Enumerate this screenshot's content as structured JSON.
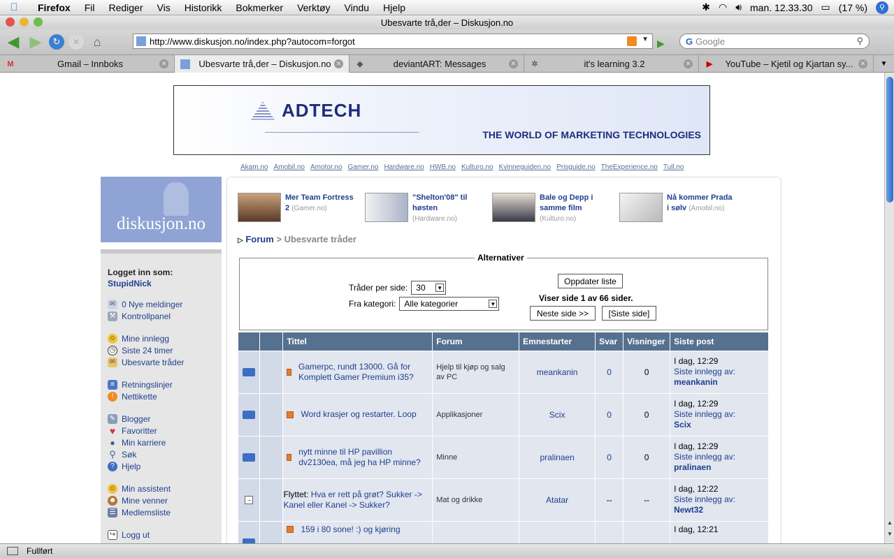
{
  "os_menu": {
    "app": "Firefox",
    "items": [
      "Fil",
      "Rediger",
      "Vis",
      "Historikk",
      "Bokmerker",
      "Verktøy",
      "Vindu",
      "Hjelp"
    ],
    "clock": "man. 12.33.30",
    "battery": "(17 %)"
  },
  "window": {
    "title": "Ubesvarte trå,der – Diskusjon.no"
  },
  "toolbar": {
    "url": "http://www.diskusjon.no/index.php?autocom=forgot",
    "search_placeholder": "Google"
  },
  "tabs": [
    {
      "label": "Gmail – Innboks",
      "icon": "gmail-icon"
    },
    {
      "label": "Ubesvarte trå,der – Diskusjon.no",
      "icon": "diskusjon-icon"
    },
    {
      "label": "deviantART: Messages",
      "icon": "deviantart-icon"
    },
    {
      "label": "it's learning 3.2",
      "icon": "loading-icon"
    },
    {
      "label": "YouTube – Kjetil og Kjartan sy...",
      "icon": "youtube-icon"
    }
  ],
  "status": {
    "text": "Fullført"
  },
  "banner": {
    "brand": "ADTECH",
    "tagline": "THE WORLD OF MARKETING TECHNOLOGIES"
  },
  "site_links": [
    "Akam.no",
    "Amobil.no",
    "Amotor.no",
    "Gamer.no",
    "Hardware.no",
    "HWB.no",
    "Kulturo.no",
    "Kvinneguiden.no",
    "Prisguide.no",
    "TheExperience.no",
    "Tull.no"
  ],
  "logo": {
    "text": "diskusjon.no"
  },
  "sidebar": {
    "logged_in_label": "Logget inn som:",
    "username": "StupidNick",
    "groups": [
      [
        {
          "label": "0 Nye meldinger",
          "icon": "envelope-icon"
        },
        {
          "label": "Kontrollpanel",
          "icon": "tools-icon"
        }
      ],
      [
        {
          "label": "Mine innlegg",
          "icon": "smiley-icon"
        },
        {
          "label": "Siste 24 timer",
          "icon": "clock-icon"
        },
        {
          "label": "Ubesvarte tråder",
          "icon": "mail-open-icon"
        }
      ],
      [
        {
          "label": "Retningslinjer",
          "icon": "rules-icon"
        },
        {
          "label": "Nettikette",
          "icon": "warning-icon"
        }
      ],
      [
        {
          "label": "Blogger",
          "icon": "blog-icon"
        },
        {
          "label": "Favoritter",
          "icon": "heart-icon"
        },
        {
          "label": "Min karriere",
          "icon": "footprints-icon"
        },
        {
          "label": "Søk",
          "icon": "search-icon"
        },
        {
          "label": "Hjelp",
          "icon": "help-icon"
        }
      ],
      [
        {
          "label": "Min assistent",
          "icon": "assistant-icon"
        },
        {
          "label": "Mine venner",
          "icon": "friends-icon"
        },
        {
          "label": "Medlemsliste",
          "icon": "members-icon"
        }
      ],
      [
        {
          "label": "Logg ut",
          "icon": "logout-icon"
        }
      ]
    ]
  },
  "news": [
    {
      "title": "Mer Team Fortress 2",
      "source": "(Gamer.no)"
    },
    {
      "title": "\"Shelton'08\" til høsten",
      "source": "(Hardware.no)"
    },
    {
      "title": "Bale og Depp i samme film",
      "source": "(Kulturo.no)"
    },
    {
      "title": "Nå kommer Prada i sølv",
      "source": "(Amobil.no)"
    }
  ],
  "breadcrumb": {
    "root": "Forum",
    "current": "> Ubesvarte tråder"
  },
  "options": {
    "legend": "Alternativer",
    "per_page_label": "Tråder per side:",
    "per_page_value": "30",
    "category_label": "Fra kategori:",
    "category_value": "Alle kategorier",
    "update_button": "Oppdater liste",
    "page_info": "Viser side 1 av 66 sider.",
    "next_button": "Neste side >>",
    "last_button": "[Siste side]"
  },
  "table": {
    "headers": [
      "",
      "",
      "Tittel",
      "Forum",
      "Emnestarter",
      "Svar",
      "Visninger",
      "Siste post"
    ],
    "rows": [
      {
        "prefix": "",
        "title": "Gamerpc, rundt 13000. Gå for Komplett Gamer Premium i35?",
        "forum": "Hjelp til kjøp og salg av PC",
        "starter": "meankanin",
        "replies": "0",
        "views": "0",
        "last_time": "I dag, 12:29",
        "last_by": "Siste innlegg av:",
        "last_user": "meankanin"
      },
      {
        "prefix": "",
        "title": "Word krasjer og restarter. Loop",
        "forum": "Applikasjoner",
        "starter": "Scix",
        "replies": "0",
        "views": "0",
        "last_time": "I dag, 12:29",
        "last_by": "Siste innlegg av:",
        "last_user": "Scix"
      },
      {
        "prefix": "",
        "title": "nytt minne til HP pavillion dv2130ea, må jeg ha HP minne?",
        "forum": "Minne",
        "starter": "pralinaen",
        "replies": "0",
        "views": "0",
        "last_time": "I dag, 12:29",
        "last_by": "Siste innlegg av:",
        "last_user": "pralinaen"
      },
      {
        "prefix": "Flyttet:",
        "title": "Hva er rett på grøt? Sukker -> Kanel eller Kanel -> Sukker?",
        "forum": "Mat og drikke",
        "starter": "Atatar",
        "replies": "--",
        "views": "--",
        "last_time": "I dag, 12:22",
        "last_by": "Siste innlegg av:",
        "last_user": "Newt32"
      },
      {
        "prefix": "",
        "title": "159 i 80 sone! :) og kjøring",
        "forum": "",
        "starter": "",
        "replies": "",
        "views": "",
        "last_time": "I dag, 12:21",
        "last_by": "",
        "last_user": ""
      }
    ]
  }
}
